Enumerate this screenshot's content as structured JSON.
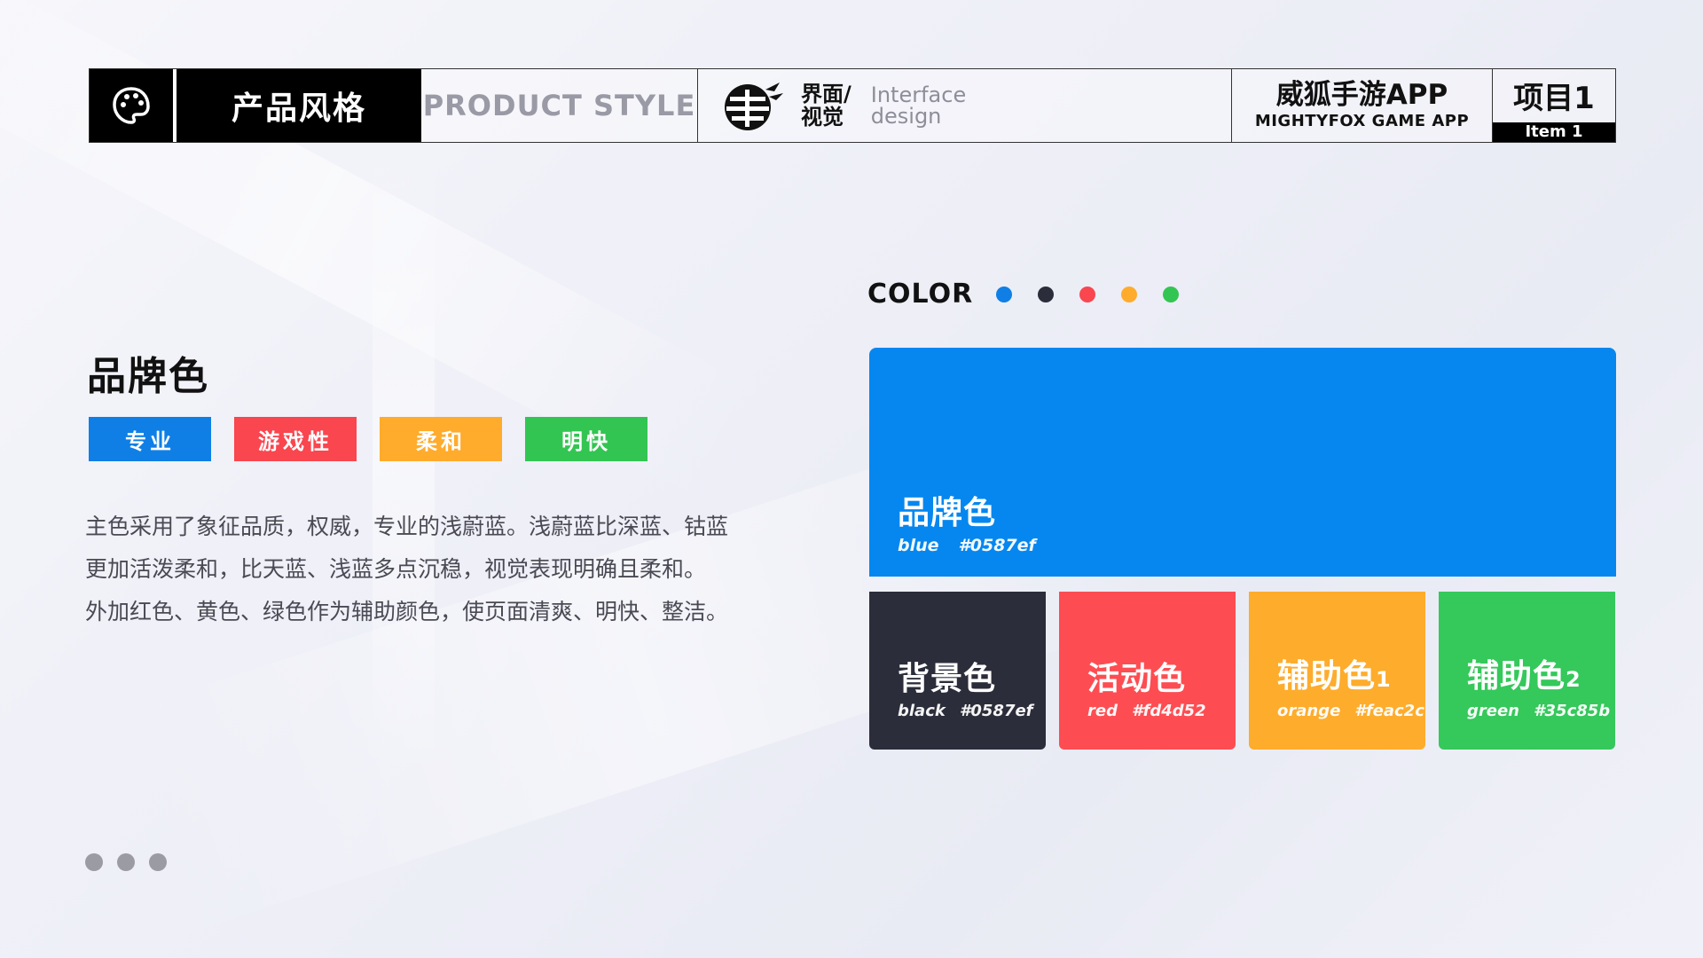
{
  "header": {
    "icon": "palette-icon",
    "title": "产品风格",
    "subtitle": "PRODUCT STYLE",
    "logo_cn_1": "界面/",
    "logo_cn_2": "视觉",
    "logo_en_1": "Interface",
    "logo_en_2": "design",
    "app_cn": "威狐手游APP",
    "app_en": "MIGHTYFOX GAME APP",
    "item_cn": "项目1",
    "item_en": "Item 1"
  },
  "brand": {
    "title": "品牌色",
    "tags": [
      {
        "label": "专业",
        "color": "#0f7fe6"
      },
      {
        "label": "游戏性",
        "color": "#f9464f"
      },
      {
        "label": "柔和",
        "color": "#ffab2c"
      },
      {
        "label": "明快",
        "color": "#33c552"
      }
    ],
    "description": [
      "主色采用了象征品质，权威，专业的浅蔚蓝。浅蔚蓝比深蓝、钴蓝",
      "更加活泼柔和，比天蓝、浅蓝多点沉稳，视觉表现明确且柔和。",
      "外加红色、黄色、绿色作为辅助颜色，使页面清爽、明快、整洁。"
    ]
  },
  "color": {
    "label": "COLOR",
    "dots": [
      "#0f7fe6",
      "#2b2d3a",
      "#f9464f",
      "#ffab2c",
      "#33c552"
    ],
    "main": {
      "title": "品牌色",
      "name": "blue",
      "hex": "#0587ef",
      "color": "#0587ef"
    },
    "swatches": [
      {
        "title": "背景色",
        "sup": "",
        "name": "black",
        "hex": "#0587ef",
        "color": "#2b2d3a"
      },
      {
        "title": "活动色",
        "sup": "",
        "name": "red",
        "hex": "#fd4d52",
        "color": "#fd4d52"
      },
      {
        "title": "辅助色",
        "sup": "1",
        "name": "orange",
        "hex": "#feac2c",
        "color": "#feac2c"
      },
      {
        "title": "辅助色",
        "sup": "2",
        "name": "green",
        "hex": "#35c85b",
        "color": "#35c85b"
      }
    ]
  },
  "pagination": {
    "dots": 3
  }
}
